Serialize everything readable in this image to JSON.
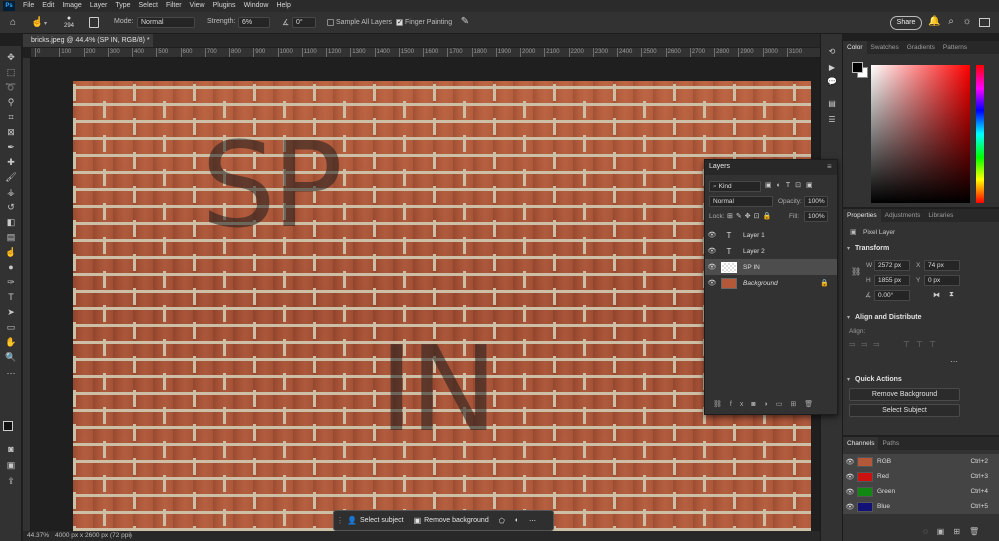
{
  "app": {
    "logo": "Ps",
    "menu": [
      "File",
      "Edit",
      "Image",
      "Layer",
      "Type",
      "Select",
      "Filter",
      "View",
      "Plugins",
      "Window",
      "Help"
    ]
  },
  "options": {
    "brush_size": "294",
    "mode_label": "Mode:",
    "mode_value": "Normal",
    "strength_label": "Strength:",
    "strength_value": "6%",
    "angle_value": "0°",
    "sample_all_layers": "Sample All Layers",
    "finger_painting": "Finger Painting",
    "share_label": "Share"
  },
  "document": {
    "tab_title": "bricks.jpeg @ 44.4% (SP IN, RGB/8) *",
    "ruler_ticks": [
      "0",
      "100",
      "200",
      "300",
      "400",
      "500",
      "600",
      "700",
      "800",
      "900",
      "1000",
      "1100",
      "1200",
      "1300",
      "1400",
      "1500",
      "1600",
      "1700",
      "1800",
      "1900",
      "2000",
      "2100",
      "2200",
      "2300",
      "2400",
      "2500",
      "2600",
      "2700",
      "2800",
      "2900",
      "3000",
      "3100"
    ],
    "overlay_text_1": "SP",
    "overlay_text_2": "IN",
    "zoom": "44.37%",
    "doc_info": "4000 px x 2600 px (72 ppi)"
  },
  "taskbar": {
    "select_subject": "Select subject",
    "remove_background": "Remove background"
  },
  "color_panel": {
    "tabs": [
      "Color",
      "Swatches",
      "Gradients",
      "Patterns"
    ]
  },
  "layers_panel": {
    "title": "Layers",
    "filter_kind": "Kind",
    "blend_mode": "Normal",
    "opacity_label": "Opacity:",
    "opacity_value": "100%",
    "lock_label": "Lock:",
    "fill_label": "Fill:",
    "fill_value": "100%",
    "layers": [
      {
        "name": "Layer 1",
        "type": "text"
      },
      {
        "name": "Layer 2",
        "type": "text"
      },
      {
        "name": "SP IN",
        "type": "pixel",
        "selected": true
      },
      {
        "name": "Background",
        "type": "image",
        "locked": true
      }
    ]
  },
  "properties_panel": {
    "tabs": [
      "Properties",
      "Adjustments",
      "Libraries"
    ],
    "pixel_layer": "Pixel Layer",
    "transform_title": "Transform",
    "w_label": "W",
    "w_value": "2572 px",
    "h_label": "H",
    "h_value": "1855 px",
    "x_label": "X",
    "x_value": "74 px",
    "y_label": "Y",
    "y_value": "0 px",
    "angle_value": "0.00°",
    "align_title": "Align and Distribute",
    "align_label": "Align:",
    "quick_actions_title": "Quick Actions",
    "remove_background": "Remove Background",
    "select_subject": "Select Subject"
  },
  "channels_panel": {
    "tabs": [
      "Channels",
      "Paths"
    ],
    "channels": [
      {
        "name": "RGB",
        "shortcut": "Ctrl+2",
        "color": "#b4583a"
      },
      {
        "name": "Red",
        "shortcut": "Ctrl+3",
        "color": "#cc1111"
      },
      {
        "name": "Green",
        "shortcut": "Ctrl+4",
        "color": "#118811"
      },
      {
        "name": "Blue",
        "shortcut": "Ctrl+5",
        "color": "#111177"
      }
    ]
  }
}
